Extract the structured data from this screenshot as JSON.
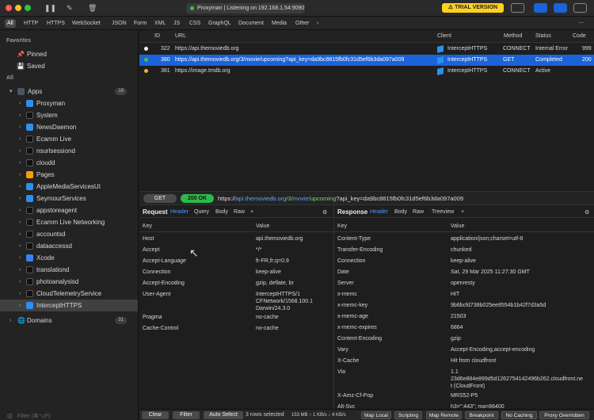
{
  "titlebar": {
    "status": "Proxyman | Listening on 192.168.1.54:9090",
    "trial": "TRIAL VERSION"
  },
  "filters": [
    "All",
    "HTTP",
    "HTTPS",
    "WebSocket",
    "JSON",
    "Form",
    "XML",
    "JS",
    "CSS",
    "GraphQL",
    "Document",
    "Media",
    "Other"
  ],
  "sidebar": {
    "favorites": "Favorites",
    "pinned": "Pinned",
    "saved": "Saved",
    "all": "All",
    "apps": "Apps",
    "apps_count": "18",
    "items": [
      "Proxyman",
      "System",
      "NewsDaemon",
      "Ecamm Live",
      "nsurlsessiond",
      "cloudd",
      "Pages",
      "AppleMediaServicesUI",
      "SeymourServices",
      "appstoreagent",
      "Ecamm Live Networking",
      "accountsd",
      "dataaccessd",
      "Xcode",
      "translationd",
      "photoanalysisd",
      "CloudTelemetryService",
      "InterceptHTTPS"
    ],
    "domains": "Domains",
    "domains_count": "31",
    "filter_placeholder": "Filter (⌘⌥F)"
  },
  "table": {
    "headers": {
      "id": "ID",
      "url": "URL",
      "client": "Client",
      "method": "Method",
      "status": "Status",
      "code": "Code"
    },
    "rows": [
      {
        "id": "322",
        "url": "https://api.themoviedb.org",
        "client": "InterceptHTTPS",
        "method": "CONNECT",
        "status": "Internal Error",
        "code": "999"
      },
      {
        "id": "380",
        "url": "https://api.themoviedb.org/3/movie/upcoming?api_key=da9bc8815fb0fc31d5ef6b3da097a009",
        "client": "InterceptHTTPS",
        "method": "GET",
        "status": "Completed",
        "code": "200"
      },
      {
        "id": "381",
        "url": "https://image.tmdb.org",
        "client": "InterceptHTTPS",
        "method": "CONNECT",
        "status": "Active",
        "code": ""
      }
    ]
  },
  "urlbar": {
    "method": "GET",
    "code": "200 OK",
    "scheme": "https://",
    "host": "api.themoviedb.org",
    "path1": "/3/",
    "path2": "movie/",
    "path3": "upcoming",
    "query": "?api_key=da9bc8815fb0fc31d5ef6b3da097a009"
  },
  "request": {
    "title": "Request",
    "tabs": [
      "Header",
      "Query",
      "Body",
      "Raw",
      "+"
    ],
    "col_key": "Key",
    "col_value": "Value",
    "rows": [
      {
        "k": "Host",
        "v": "api.themoviedb.org"
      },
      {
        "k": "Accept",
        "v": "*/*"
      },
      {
        "k": "Accept-Language",
        "v": "fr-FR,fr;q=0.9"
      },
      {
        "k": "Connection",
        "v": "keep-alive"
      },
      {
        "k": "Accept-Encoding",
        "v": "gzip, deflate, br"
      },
      {
        "k": "User-Agent",
        "v": "InterceptHTTPS/1\nCFNetwork/1568.100.1\nDarwin/24.3.0"
      },
      {
        "k": "Pragma",
        "v": "no-cache"
      },
      {
        "k": "Cache-Control",
        "v": "no-cache"
      }
    ]
  },
  "response": {
    "title": "Response",
    "tabs": [
      "Header",
      "Body",
      "Raw",
      "Treeview",
      "+"
    ],
    "col_key": "Key",
    "col_value": "Value",
    "rows": [
      {
        "k": "Content-Type",
        "v": "application/json;charset=utf-8"
      },
      {
        "k": "Transfer-Encoding",
        "v": "chunked"
      },
      {
        "k": "Connection",
        "v": "keep-alive"
      },
      {
        "k": "Date",
        "v": "Sat, 29 Mar 2025 11:27:30 GMT"
      },
      {
        "k": "Server",
        "v": "openresty"
      },
      {
        "k": "x-memc",
        "v": "HIT"
      },
      {
        "k": "x-memc-key",
        "v": "9b6bcfd738b025ee8554b1b42f7d3a5d"
      },
      {
        "k": "x-memc-age",
        "v": "21503"
      },
      {
        "k": "x-memc-expires",
        "v": "6864"
      },
      {
        "k": "Content-Encoding",
        "v": "gzip"
      },
      {
        "k": "Vary",
        "v": "Accept-Encoding,accept-encoding"
      },
      {
        "k": "X-Cache",
        "v": "Hit from cloudfront"
      },
      {
        "k": "Via",
        "v": "1.1\n23d6e884e899d5d1262754142496b262.cloudfront.ne\nt (CloudFront)"
      },
      {
        "k": "X-Amz-Cf-Pop",
        "v": "MRS52-P5"
      },
      {
        "k": "Alt-Svc",
        "v": "h3=\":443\"; ma=86400"
      }
    ]
  },
  "bottombar": {
    "clear": "Clear",
    "filter": "Filter",
    "autoselect": "Auto Select",
    "rows": "3 rows selected",
    "stats": "153 MB ↑ 1 KB/s ↓ 4 KB/s",
    "tags": [
      "Map Local",
      "Scripting",
      "Map Remote",
      "Breakpoint",
      "No Caching",
      "Proxy Overridden"
    ]
  },
  "colors": {
    "accent": "#1a63d8",
    "trial": "#ffd21e",
    "ok": "#2eb84a",
    "link": "#4a9bff"
  }
}
